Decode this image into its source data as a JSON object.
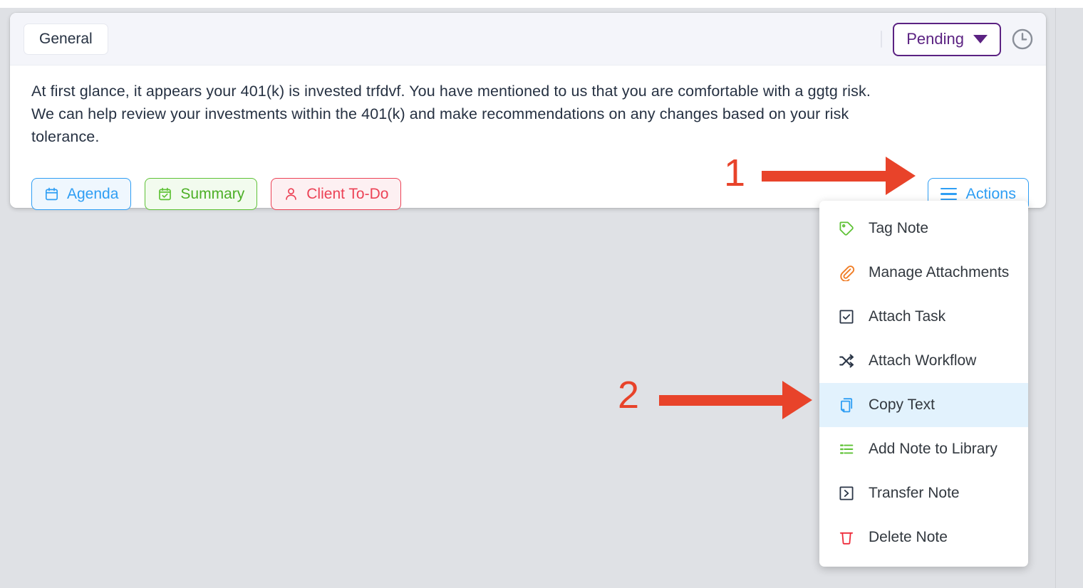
{
  "card": {
    "tab_label": "General",
    "status": {
      "label": "Pending",
      "color": "#5b2282",
      "caret_icon": "chevron-down-icon"
    },
    "history_icon": "clock-icon",
    "note_text": "At first glance, it appears your 401(k) is invested trfdvf. You have mentioned to us that you are comfortable with a ggtg risk. We can help review your investments within the 401(k) and make recommendations on any changes based on your risk tolerance.",
    "tags": [
      {
        "label": "Agenda",
        "icon": "calendar-icon",
        "color": "#2e9ef4"
      },
      {
        "label": "Summary",
        "icon": "checked-square-icon",
        "color": "#4caf26"
      },
      {
        "label": "Client To-Do",
        "icon": "person-icon",
        "color": "#ec4256"
      }
    ],
    "actions_button": {
      "label": "Actions",
      "icon": "hamburger-icon",
      "color": "#2e9ef4"
    }
  },
  "actions_menu": {
    "items": [
      {
        "label": "Tag Note",
        "icon": "tag-icon",
        "icon_color": "#5ec235",
        "highlighted": false
      },
      {
        "label": "Manage Attachments",
        "icon": "paperclip-icon",
        "icon_color": "#f07d26",
        "highlighted": false
      },
      {
        "label": "Attach Task",
        "icon": "checkbox-icon",
        "icon_color": "#2b3647",
        "highlighted": false
      },
      {
        "label": "Attach Workflow",
        "icon": "shuffle-icon",
        "icon_color": "#2b3647",
        "highlighted": false
      },
      {
        "label": "Copy Text",
        "icon": "copy-icon",
        "icon_color": "#2e9ef4",
        "highlighted": true
      },
      {
        "label": "Add Note to Library",
        "icon": "list-icon",
        "icon_color": "#5ec235",
        "highlighted": false
      },
      {
        "label": "Transfer Note",
        "icon": "boxed-arrow-icon",
        "icon_color": "#2b3647",
        "highlighted": false
      },
      {
        "label": "Delete Note",
        "icon": "trash-icon",
        "icon_color": "#ee2b3a",
        "highlighted": false
      }
    ]
  },
  "annotations": {
    "color": "#e8432a",
    "steps": [
      {
        "number": "1"
      },
      {
        "number": "2"
      }
    ]
  }
}
